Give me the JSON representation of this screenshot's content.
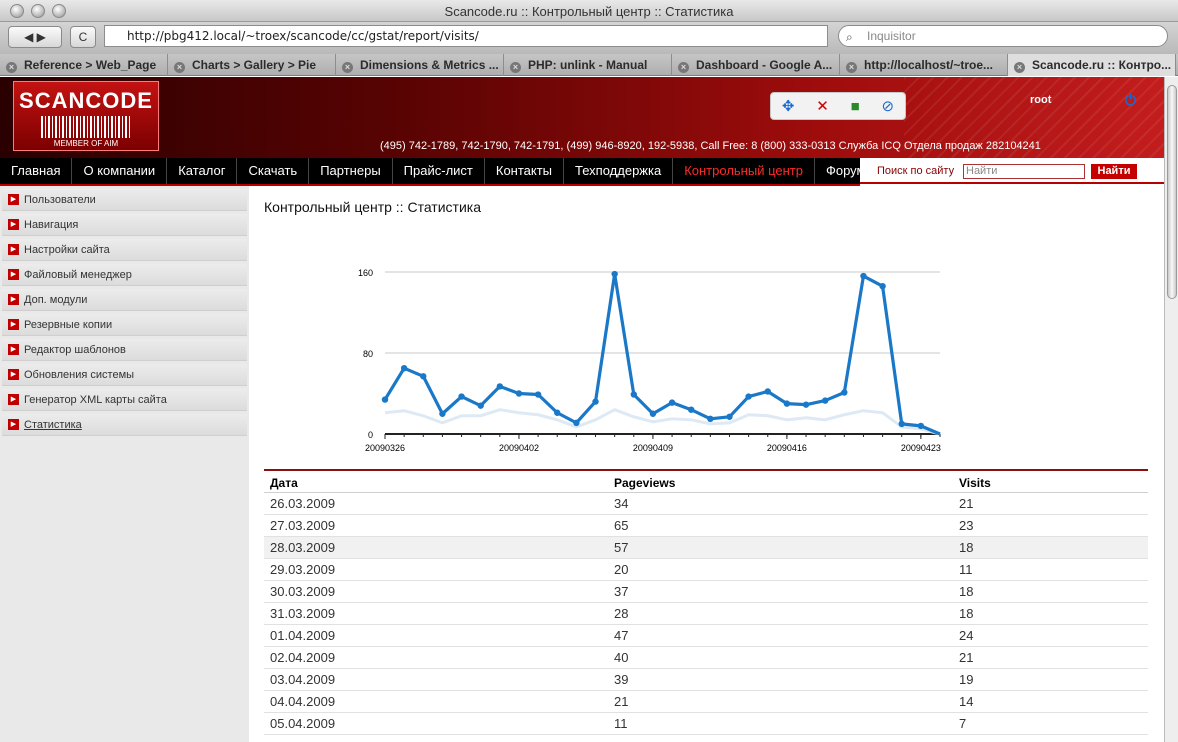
{
  "window": {
    "title": "Scancode.ru :: Контрольный центр :: Статистика"
  },
  "toolbar": {
    "back_label": "◀ ▶",
    "reload_label": "C",
    "url": "http://pbg412.local/~troex/scancode/cc/gstat/report/visits/",
    "search_placeholder": "Inquisitor"
  },
  "tabs": [
    {
      "label": "Reference > Web_Page"
    },
    {
      "label": "Charts > Gallery > Pie"
    },
    {
      "label": "Dimensions & Metrics ..."
    },
    {
      "label": "PHP: unlink - Manual"
    },
    {
      "label": "Dashboard - Google A..."
    },
    {
      "label": "http://localhost/~troe..."
    },
    {
      "label": "Scancode.ru :: Контро..."
    }
  ],
  "header": {
    "logo_text": "SCANCODE",
    "logo_sub": "MEMBER OF AIM",
    "phones": "(495) 742-1789, 742-1790, 742-1791, (499) 946-8920, 192-5938, Call Free: 8 (800) 333-0313 Служба ICQ Отдела продаж 282104241",
    "user": "root"
  },
  "menu": [
    {
      "label": "Главная"
    },
    {
      "label": "О компании"
    },
    {
      "label": "Каталог"
    },
    {
      "label": "Скачать"
    },
    {
      "label": "Партнеры"
    },
    {
      "label": "Прайс-лист"
    },
    {
      "label": "Контакты"
    },
    {
      "label": "Техподдержка"
    },
    {
      "label": "Контрольный центр"
    },
    {
      "label": "Форум"
    }
  ],
  "site_search": {
    "label": "Поиск по сайту",
    "placeholder": "Найти",
    "button": "Найти"
  },
  "sidebar": {
    "items": [
      {
        "label": "Пользователи"
      },
      {
        "label": "Навигация"
      },
      {
        "label": "Настройки сайта"
      },
      {
        "label": "Файловый менеджер"
      },
      {
        "label": "Доп. модули"
      },
      {
        "label": "Резервные копии"
      },
      {
        "label": "Редактор шаблонов"
      },
      {
        "label": "Обновления системы"
      },
      {
        "label": "Генератор XML карты сайта"
      },
      {
        "label": "Статистика"
      }
    ]
  },
  "page_title": "Контрольный центр :: Статистика",
  "chart_data": {
    "type": "line",
    "x_ticks": [
      "20090326",
      "20090402",
      "20090409",
      "20090416",
      "20090423"
    ],
    "y_ticks": [
      0,
      80,
      160
    ],
    "ylim": [
      0,
      160
    ],
    "colors": {
      "pageviews": "#1a78c8",
      "visits": "#dde9f4"
    },
    "series": [
      {
        "key": "pageviews",
        "values": [
          34,
          65,
          57,
          20,
          37,
          28,
          47,
          40,
          39,
          21,
          11,
          32,
          158,
          39,
          20,
          31,
          24,
          15,
          17,
          37,
          42,
          30,
          29,
          33,
          41,
          156,
          146,
          10,
          8,
          0
        ]
      },
      {
        "key": "visits",
        "values": [
          21,
          23,
          18,
          11,
          18,
          18,
          24,
          21,
          19,
          14,
          7,
          14,
          24,
          17,
          12,
          15,
          14,
          10,
          11,
          19,
          18,
          14,
          16,
          14,
          19,
          23,
          21,
          7,
          5,
          0
        ]
      }
    ],
    "grid": true
  },
  "table": {
    "headers": [
      "Дата",
      "Pageviews",
      "Visits"
    ],
    "rows": [
      [
        "26.03.2009",
        "34",
        "21"
      ],
      [
        "27.03.2009",
        "65",
        "23"
      ],
      [
        "28.03.2009",
        "57",
        "18"
      ],
      [
        "29.03.2009",
        "20",
        "11"
      ],
      [
        "30.03.2009",
        "37",
        "18"
      ],
      [
        "31.03.2009",
        "28",
        "18"
      ],
      [
        "01.04.2009",
        "47",
        "24"
      ],
      [
        "02.04.2009",
        "40",
        "21"
      ],
      [
        "03.04.2009",
        "39",
        "19"
      ],
      [
        "04.04.2009",
        "21",
        "14"
      ],
      [
        "05.04.2009",
        "11",
        "7"
      ]
    ]
  }
}
